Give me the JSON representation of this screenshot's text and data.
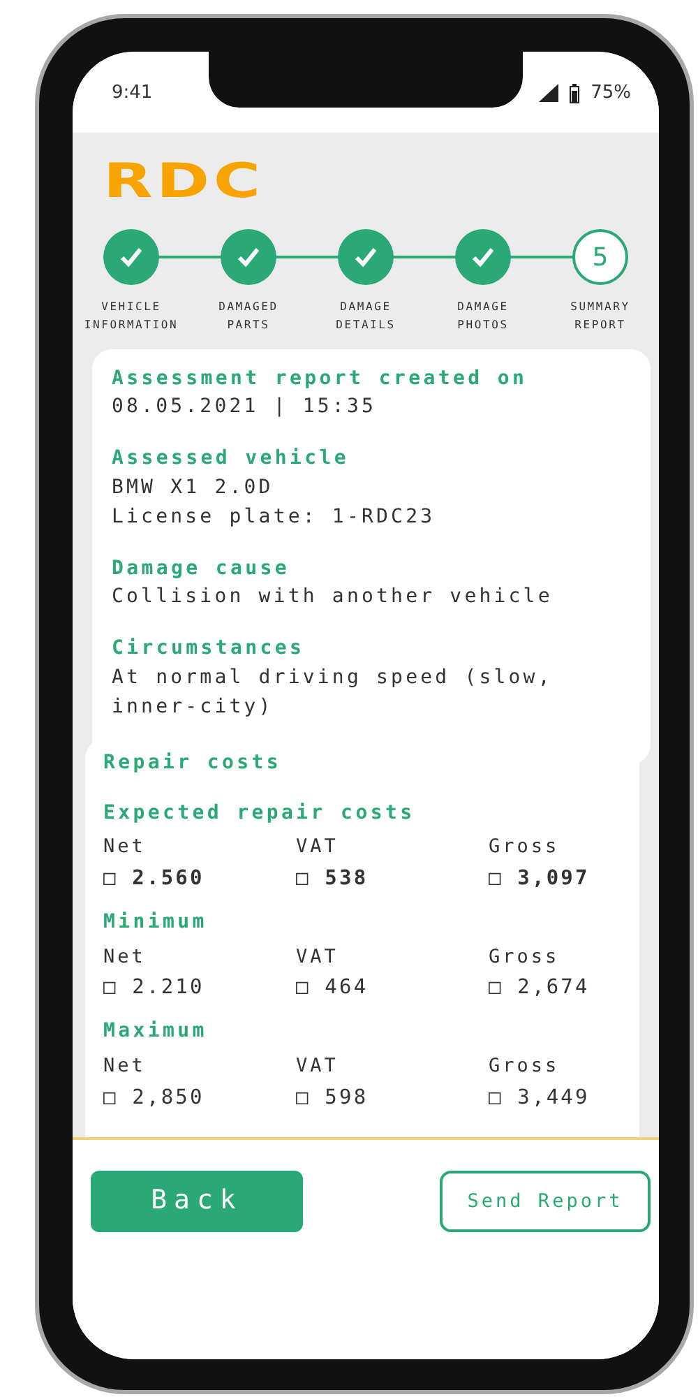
{
  "status_bar": {
    "time": "9:41",
    "battery": "75%"
  },
  "logo": "RDC",
  "steps": [
    {
      "label": "VEHICLE INFORMATION",
      "done": true
    },
    {
      "label": "DAMAGED PARTS",
      "done": true
    },
    {
      "label": "DAMAGE DETAILS",
      "done": true
    },
    {
      "label": "DAMAGE PHOTOS",
      "done": true
    },
    {
      "label": "SUMMARY REPORT",
      "done": false,
      "number": "5"
    }
  ],
  "sections": [
    {
      "heading": "Assessment report created on",
      "lines": [
        "08.05.2021 | 15:35"
      ]
    },
    {
      "heading": "Assessed vehicle",
      "lines": [
        "BMW X1 2.0D",
        "License plate: 1-RDC23"
      ]
    },
    {
      "heading": "Damage cause",
      "lines": [
        "Collision with another vehicle"
      ]
    },
    {
      "heading": "Circumstances",
      "lines": [
        "At normal driving speed (slow, inner-city)"
      ]
    }
  ],
  "repair_costs": {
    "title": "Repair costs",
    "groups": [
      {
        "heading": "Expected repair costs",
        "emphasis": true,
        "cells": [
          {
            "label": "Net",
            "value": "□ 2.560"
          },
          {
            "label": "VAT",
            "value": "□ 538"
          },
          {
            "label": "Gross",
            "value": "□ 3,097"
          }
        ]
      },
      {
        "heading": "Minimum",
        "emphasis": false,
        "cells": [
          {
            "label": "Net",
            "value": "□ 2.210"
          },
          {
            "label": "VAT",
            "value": "□ 464"
          },
          {
            "label": "Gross",
            "value": "□ 2,674"
          }
        ]
      },
      {
        "heading": "Maximum",
        "emphasis": false,
        "cells": [
          {
            "label": "Net",
            "value": "□ 2,850"
          },
          {
            "label": "VAT",
            "value": "□ 598"
          },
          {
            "label": "Gross",
            "value": "□ 3,449"
          }
        ]
      }
    ]
  },
  "buttons": [
    {
      "label": "Back",
      "kind": "primary"
    },
    {
      "label": "Send Report",
      "kind": "outline"
    }
  ]
}
